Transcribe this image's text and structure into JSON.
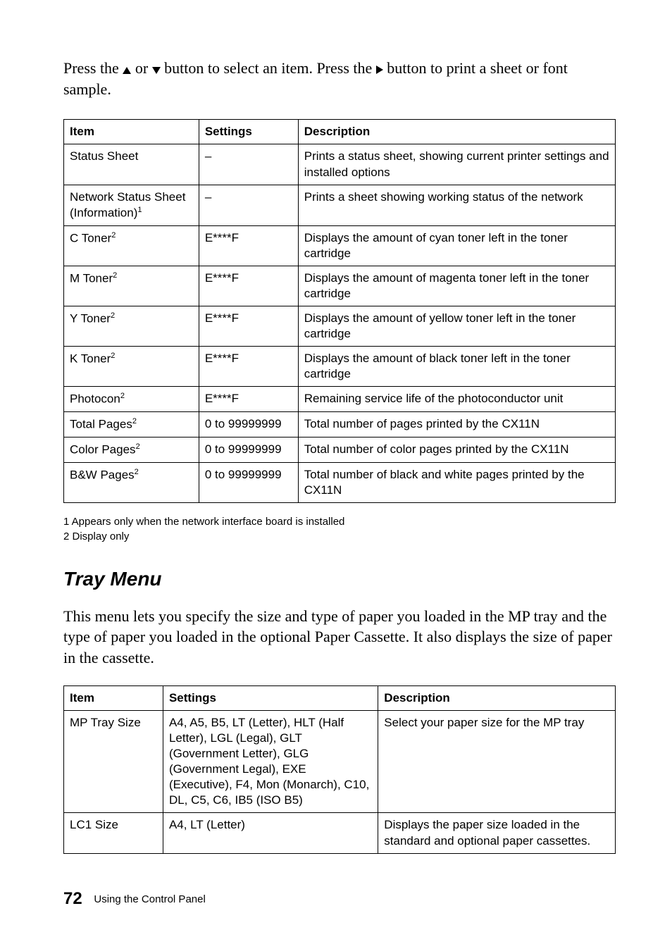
{
  "intro": {
    "part1": "Press the ",
    "part2": " or ",
    "part3": " button to select an item. Press the ",
    "part4": " button to print a sheet or font sample."
  },
  "table1": {
    "headers": {
      "item": "Item",
      "settings": "Settings",
      "description": "Description"
    },
    "rows": [
      {
        "item": "Status Sheet",
        "settings": "–",
        "description": "Prints a status sheet, showing current printer settings and installed options"
      },
      {
        "item": "Network Status Sheet (Information)",
        "sup": "1",
        "settings": "–",
        "description": "Prints a sheet showing working status of the network"
      },
      {
        "item": "C Toner",
        "sup": "2",
        "settings": "E****F",
        "description": "Displays the amount of cyan toner left in the toner cartridge"
      },
      {
        "item": "M Toner",
        "sup": "2",
        "settings": "E****F",
        "description": "Displays the amount of magenta toner left in the toner cartridge"
      },
      {
        "item": "Y Toner",
        "sup": "2",
        "settings": "E****F",
        "description": "Displays the amount of yellow toner left in the toner cartridge"
      },
      {
        "item": "K Toner",
        "sup": "2",
        "settings": "E****F",
        "description": "Displays the amount of black toner left in the toner cartridge"
      },
      {
        "item": "Photocon",
        "sup": "2",
        "settings": "E****F",
        "description": "Remaining service life of the photoconductor unit"
      },
      {
        "item": "Total Pages",
        "sup": "2",
        "settings": "0 to 99999999",
        "description": "Total number of pages printed by the CX11N"
      },
      {
        "item": "Color Pages",
        "sup": "2",
        "settings": "0 to 99999999",
        "description": "Total number of color pages printed by the CX11N"
      },
      {
        "item": "B&W Pages",
        "sup": "2",
        "settings": "0 to 99999999",
        "description": "Total number of black and white pages printed by the CX11N"
      }
    ]
  },
  "footnotes": {
    "f1": "1 Appears only when the network interface board is installed",
    "f2": "2 Display only"
  },
  "section_title": "Tray Menu",
  "section_body": "This menu lets you specify the size and type of paper you loaded in the MP tray and the type of paper you loaded in the optional Paper Cassette. It also displays the size of paper in the cassette.",
  "table2": {
    "headers": {
      "item": "Item",
      "settings": "Settings",
      "description": "Description"
    },
    "rows": [
      {
        "item": "MP Tray Size",
        "settings": "A4, A5, B5, LT (Letter), HLT (Half Letter), LGL (Legal), GLT (Government Letter), GLG (Government Legal), EXE (Executive), F4, Mon (Monarch), C10, DL, C5, C6, IB5 (ISO B5)",
        "description": "Select your paper size for the MP tray"
      },
      {
        "item": "LC1 Size",
        "settings": "A4, LT (Letter)",
        "description": "Displays the paper size loaded in the standard and optional paper cassettes."
      }
    ]
  },
  "pagefoot": {
    "number": "72",
    "label": "Using the Control Panel"
  }
}
